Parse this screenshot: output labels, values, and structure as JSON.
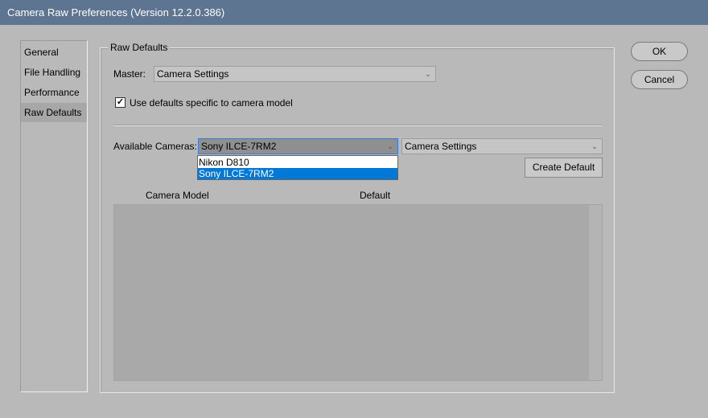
{
  "window": {
    "title": "Camera Raw Preferences  (Version 12.2.0.386)"
  },
  "sidebar": {
    "items": [
      {
        "label": "General",
        "selected": false
      },
      {
        "label": "File Handling",
        "selected": false
      },
      {
        "label": "Performance",
        "selected": false
      },
      {
        "label": "Raw Defaults",
        "selected": true
      }
    ]
  },
  "raw_defaults": {
    "group_title": "Raw Defaults",
    "master_label": "Master:",
    "master_value": "Camera Settings",
    "use_defaults_label": "Use defaults specific to camera model",
    "use_defaults_checked": true,
    "available_cameras_label": "Available Cameras:",
    "available_cameras_value": "Sony ILCE-7RM2",
    "camera_setting_value": "Camera Settings",
    "create_default_label": "Create Default",
    "dropdown_options": [
      "Nikon D810",
      "Sony ILCE-7RM2"
    ],
    "dropdown_selected": "Sony ILCE-7RM2",
    "table": {
      "columns": [
        "Camera Model",
        "Default"
      ],
      "rows": []
    }
  },
  "buttons": {
    "ok": "OK",
    "cancel": "Cancel"
  },
  "icons": {
    "combo_arrow": "chevron-down-icon",
    "checkbox": "check-icon"
  },
  "colors": {
    "titlebar": "#5d7590",
    "background": "#b9b9b9",
    "selection": "#0078d7"
  }
}
